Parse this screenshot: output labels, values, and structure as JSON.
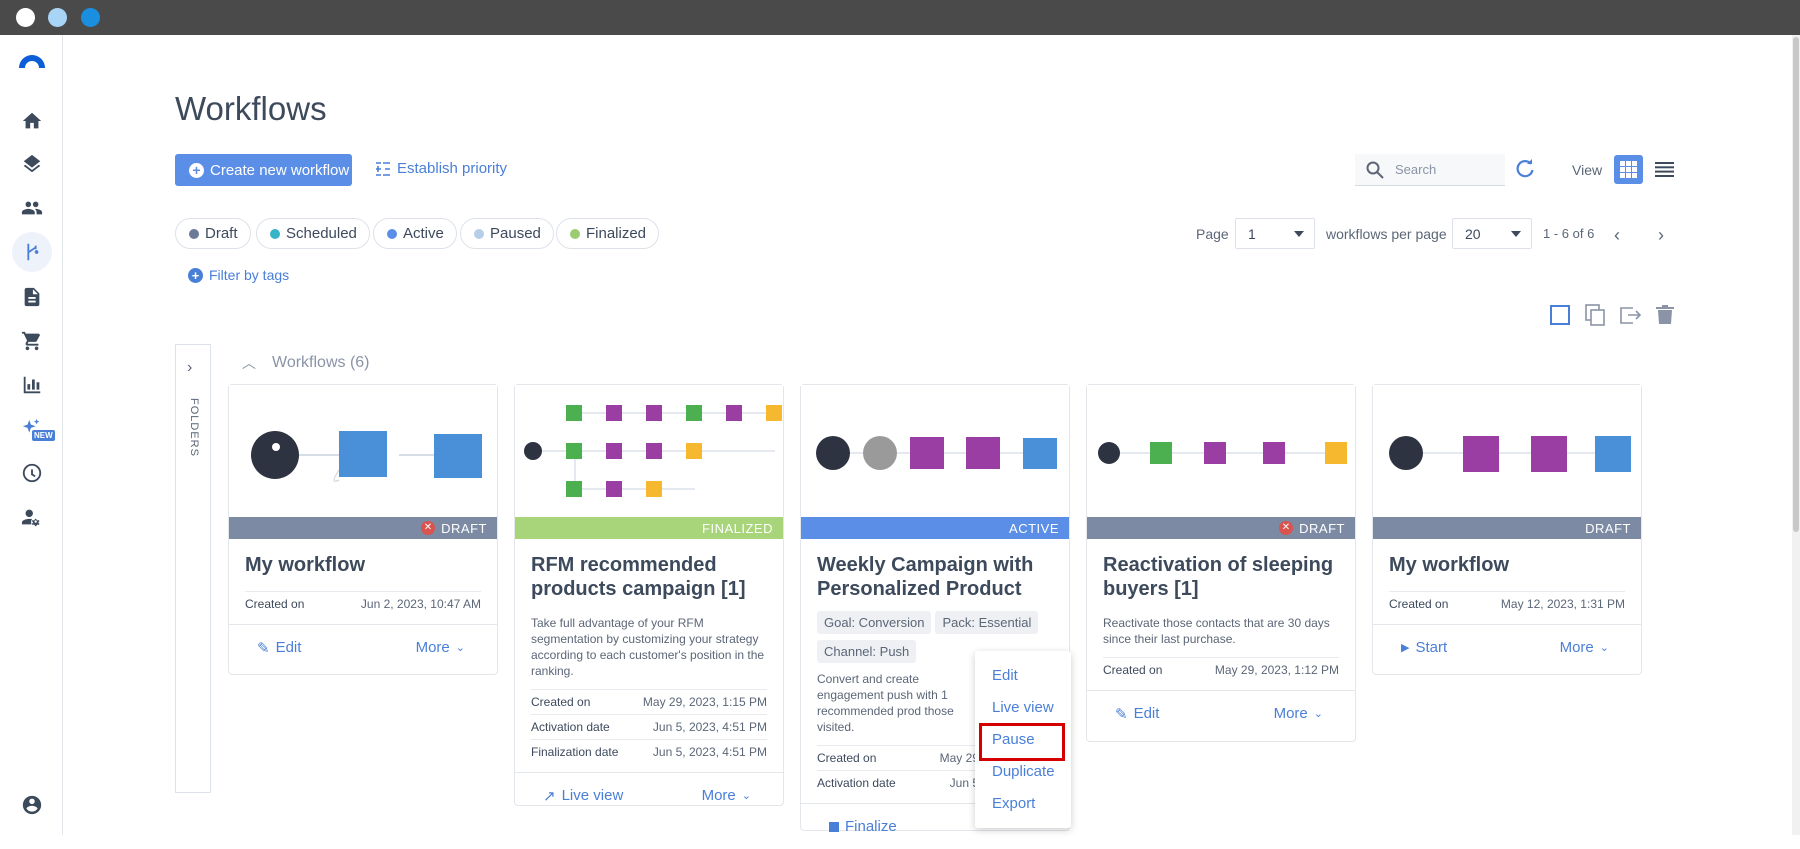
{
  "window": {
    "dots": [
      "#ffffff",
      "#a8d4f5",
      "#1a8fe0"
    ]
  },
  "sidebar": {
    "items": [
      {
        "icon": "home-icon"
      },
      {
        "icon": "layers-icon"
      },
      {
        "icon": "contacts-icon"
      },
      {
        "icon": "workflows-icon",
        "active": true
      },
      {
        "icon": "document-icon"
      },
      {
        "icon": "cart-icon"
      },
      {
        "icon": "chart-icon"
      },
      {
        "icon": "sparkle-new-icon",
        "badge": "NEW"
      },
      {
        "icon": "gauge-icon"
      },
      {
        "icon": "user-settings-icon"
      },
      {
        "icon": "account-icon"
      }
    ]
  },
  "header": {
    "title": "Workflows",
    "create_label": "Create new workflow",
    "priority_label": "Establish priority",
    "search_placeholder": "Search",
    "view_label": "View"
  },
  "filters": {
    "chips": [
      {
        "label": "Draft",
        "color": "#6b7a99"
      },
      {
        "label": "Scheduled",
        "color": "#34b3c9"
      },
      {
        "label": "Active",
        "color": "#5b8ee6"
      },
      {
        "label": "Paused",
        "color": "#b7cde9"
      },
      {
        "label": "Finalized",
        "color": "#9acd72"
      }
    ],
    "filter_tags_label": "Filter by tags"
  },
  "pagination": {
    "page_label": "Page",
    "page_value": "1",
    "per_page_label": "workflows per page",
    "per_page_value": "20",
    "range": "1 - 6 of 6"
  },
  "folders": {
    "label": "FOLDERS"
  },
  "list": {
    "header": "Workflows (6)"
  },
  "cards": [
    {
      "title": "My workflow",
      "status": "DRAFT",
      "status_color": "#7d8aa3",
      "meta": [
        {
          "label": "Created on",
          "value": "Jun 2, 2023, 10:47 AM"
        }
      ],
      "primary_action": "Edit",
      "more": "More"
    },
    {
      "title": "RFM recommended products campaign [1]",
      "status": "FINALIZED",
      "status_color": "#a8d47a",
      "description": "Take full advantage of your RFM segmentation by customizing your strategy according to each customer's position in the ranking.",
      "meta": [
        {
          "label": "Created on",
          "value": "May 29, 2023, 1:15 PM"
        },
        {
          "label": "Activation date",
          "value": "Jun 5, 2023, 4:51 PM"
        },
        {
          "label": "Finalization date",
          "value": "Jun 5, 2023, 4:51 PM"
        }
      ],
      "primary_action": "Live view",
      "more": "More"
    },
    {
      "title": "Weekly Campaign with Personalized Product",
      "status": "ACTIVE",
      "status_color": "#5b8ee6",
      "tags": [
        "Goal: Conversion",
        "Pack: Essential",
        "Channel: Push"
      ],
      "description": "Convert and create engagement push with 1 recommended prod those visited.",
      "meta": [
        {
          "label": "Created on",
          "value": "May 29"
        },
        {
          "label": "Activation date",
          "value": "Jun 5"
        }
      ],
      "primary_action": "Finalize"
    },
    {
      "title": "Reactivation of sleeping buyers [1]",
      "status": "DRAFT",
      "status_color": "#7d8aa3",
      "description": "Reactivate those contacts that are 30 days since their last purchase.",
      "meta": [
        {
          "label": "Created on",
          "value": "May 29, 2023, 1:12 PM"
        }
      ],
      "primary_action": "Edit",
      "more": "More"
    },
    {
      "title": "My workflow",
      "status": "DRAFT",
      "status_color": "#7d8aa3",
      "meta": [
        {
          "label": "Created on",
          "value": "May 12, 2023, 1:31 PM"
        }
      ],
      "primary_action": "Start",
      "more": "More"
    }
  ],
  "context_menu": {
    "items": [
      "Edit",
      "Live view",
      "Pause",
      "Duplicate",
      "Export"
    ],
    "highlighted": "Pause"
  }
}
